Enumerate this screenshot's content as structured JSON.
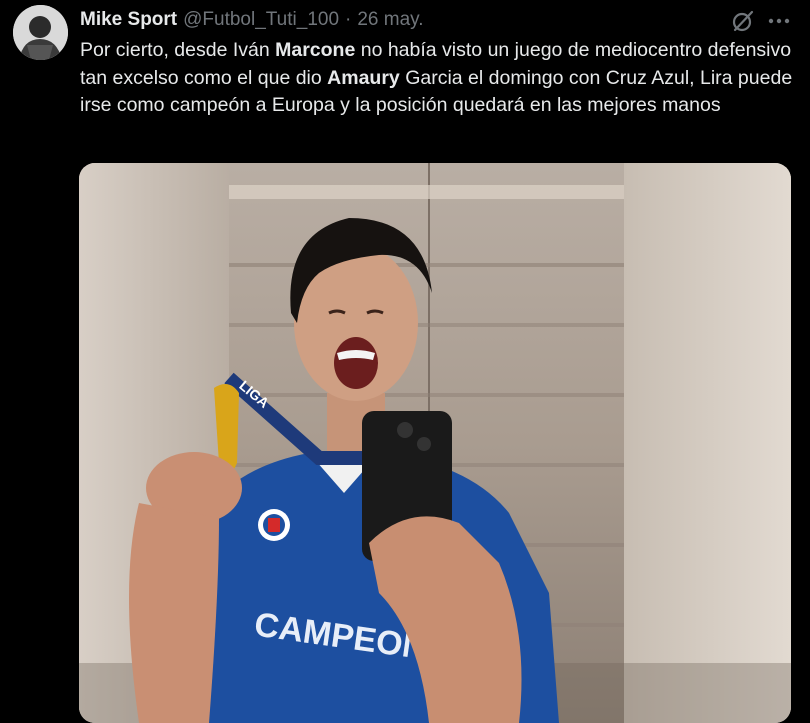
{
  "author": {
    "display_name": "Mike Sport",
    "handle": "@Futbol_Tuti_100",
    "separator": "·",
    "date": "26 may."
  },
  "tweet": {
    "t1": "Por cierto, desde Iván ",
    "b1": "Marcone",
    "t2": " no había visto un juego de mediocentro defensivo tan excelso como el que dio ",
    "b2": "Amaury",
    "t3": " Garcia el domingo con Cruz Azul, Lira puede irse como campeón a Europa y la posición quedará en las mejores manos"
  },
  "media": {
    "jersey_text": "CAMPEON",
    "lanyard_text": "LIGA"
  },
  "icons": {
    "grok": "grok-icon",
    "more": "more-icon"
  },
  "colors": {
    "background": "#000000",
    "primary_text": "#e7e9ea",
    "secondary_text": "#71767b",
    "jersey": "#1d4fa0"
  }
}
